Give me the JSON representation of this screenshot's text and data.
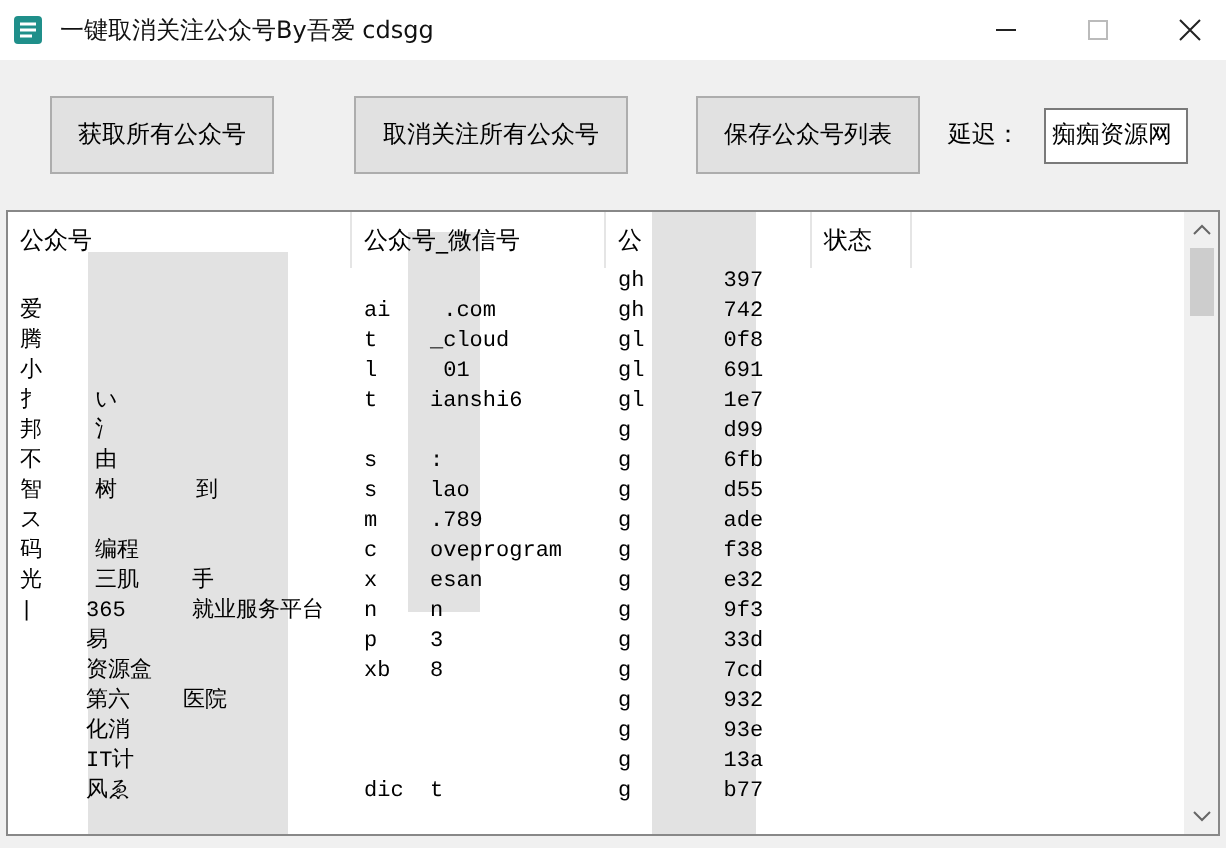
{
  "window": {
    "title": "一键取消关注公众号By吾爱 cdsgg"
  },
  "buttons": [
    "获取所有公众号",
    "取消关注所有公众号",
    "保存公众号列表"
  ],
  "delay": {
    "label": "延迟：",
    "value": "痴痴资源网"
  },
  "table": {
    "columns": [
      "公众号",
      "公众号_微信号",
      "公",
      "状态"
    ],
    "rows": [
      [
        "",
        "",
        "gh      397"
      ],
      [
        "爱",
        "ai    .com",
        "gh      742"
      ],
      [
        "腾",
        "t    _cloud",
        "gl      0f8"
      ],
      [
        "小",
        "l     01",
        "gl      691"
      ],
      [
        "扌    い",
        "t    ianshi6",
        "gl      1e7"
      ],
      [
        "邦    氵",
        "",
        "g       d99"
      ],
      [
        "不    由",
        "s    :",
        "g       6fb"
      ],
      [
        "智    树      到",
        "s    lao",
        "g       d55"
      ],
      [
        "ス",
        "m    .789",
        "g       ade"
      ],
      [
        "码    编程",
        "c    oveprogram",
        "g       f38"
      ],
      [
        "光    三肌    手",
        "x    esan",
        "g       e32"
      ],
      [
        "|    365     就业服务平台",
        "n    n",
        "g       9f3"
      ],
      [
        "     易",
        "p    3",
        "g       33d"
      ],
      [
        "     资源盒",
        "xb   8",
        "g       7cd"
      ],
      [
        "     第六    医院",
        "",
        "g       932"
      ],
      [
        "     化消",
        "",
        "g       93e"
      ],
      [
        "     IT计",
        "",
        "g       13a"
      ],
      [
        "     风ゑ",
        "dic  t",
        "g       b77"
      ]
    ]
  }
}
